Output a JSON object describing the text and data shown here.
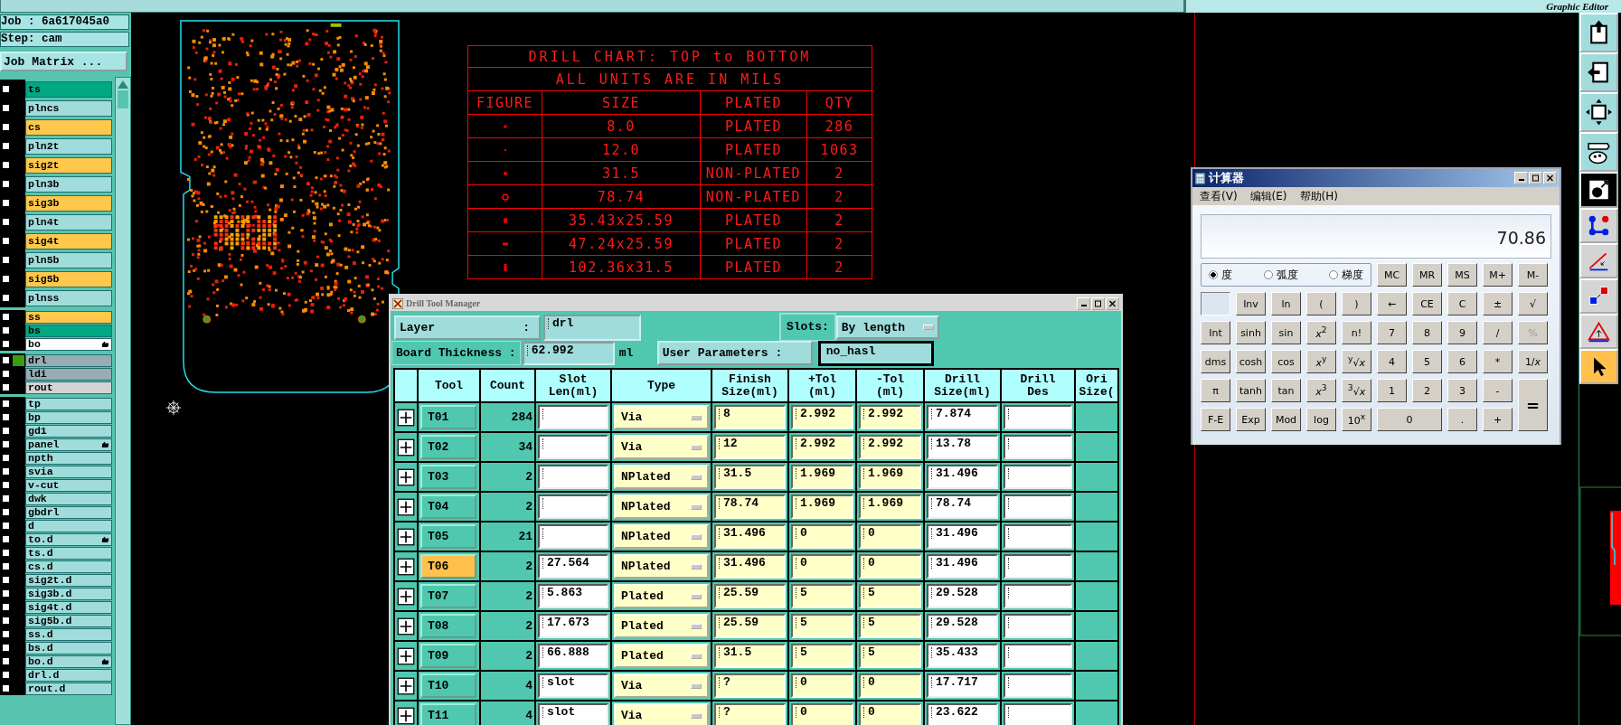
{
  "top_bar": {
    "title": "Graphic Editor"
  },
  "job": {
    "job": "Job : 6a617045a0",
    "step": "Step: cam",
    "matrix_button": "Job Matrix ..."
  },
  "layer_groups": [
    {
      "layers": [
        {
          "name": "ts",
          "color": "#00a884",
          "checked": false,
          "active": false,
          "tagged": false
        },
        {
          "name": "plncs",
          "color": "#a0dcdc",
          "checked": false,
          "active": false,
          "tagged": false
        },
        {
          "name": "cs",
          "color": "#ffc84c",
          "checked": false,
          "active": false,
          "tagged": false
        },
        {
          "name": "pln2t",
          "color": "#a0dcdc",
          "checked": false,
          "active": false,
          "tagged": false
        },
        {
          "name": "sig2t",
          "color": "#ffc84c",
          "checked": false,
          "active": false,
          "tagged": false
        },
        {
          "name": "pln3b",
          "color": "#a0dcdc",
          "checked": false,
          "active": false,
          "tagged": false
        },
        {
          "name": "sig3b",
          "color": "#ffc84c",
          "checked": false,
          "active": false,
          "tagged": false
        },
        {
          "name": "pln4t",
          "color": "#a0dcdc",
          "checked": false,
          "active": false,
          "tagged": false
        },
        {
          "name": "sig4t",
          "color": "#ffc84c",
          "checked": false,
          "active": false,
          "tagged": false
        },
        {
          "name": "pln5b",
          "color": "#a0dcdc",
          "checked": false,
          "active": false,
          "tagged": false
        },
        {
          "name": "sig5b",
          "color": "#ffc84c",
          "checked": false,
          "active": false,
          "tagged": false
        },
        {
          "name": "plnss",
          "color": "#a0dcdc",
          "checked": false,
          "active": false,
          "tagged": false
        }
      ]
    },
    {
      "layers": [
        {
          "name": "ss",
          "color": "#ffc84c",
          "checked": false,
          "active": false,
          "tagged": false
        },
        {
          "name": "bs",
          "color": "#00a884",
          "checked": false,
          "active": false,
          "tagged": false
        },
        {
          "name": "bo",
          "color": "#ffffff",
          "checked": false,
          "active": false,
          "tagged": true
        }
      ]
    },
    {
      "layers": [
        {
          "name": "drl",
          "color": "#98acb4",
          "checked": false,
          "active": true,
          "tagged": false
        },
        {
          "name": "ldi",
          "color": "#98acb4",
          "checked": false,
          "active": false,
          "tagged": false
        },
        {
          "name": "rout",
          "color": "#d4d4d4",
          "checked": false,
          "active": false,
          "tagged": false
        }
      ]
    },
    {
      "layers": [
        {
          "name": "tp",
          "color": "#a0dcdc",
          "checked": false,
          "active": false,
          "tagged": false
        },
        {
          "name": "bp",
          "color": "#a0dcdc",
          "checked": false,
          "active": false,
          "tagged": false
        },
        {
          "name": "gd1",
          "color": "#a0dcdc",
          "checked": false,
          "active": false,
          "tagged": false
        },
        {
          "name": "panel",
          "color": "#a0dcdc",
          "checked": false,
          "active": false,
          "tagged": true
        },
        {
          "name": "npth",
          "color": "#a0dcdc",
          "checked": false,
          "active": false,
          "tagged": false
        },
        {
          "name": "svia",
          "color": "#a0dcdc",
          "checked": false,
          "active": false,
          "tagged": false
        },
        {
          "name": "v-cut",
          "color": "#a0dcdc",
          "checked": false,
          "active": false,
          "tagged": false
        },
        {
          "name": "dwk",
          "color": "#a0dcdc",
          "checked": false,
          "active": false,
          "tagged": false
        },
        {
          "name": "gbdrl",
          "color": "#a0dcdc",
          "checked": false,
          "active": false,
          "tagged": false
        },
        {
          "name": "d",
          "color": "#a0dcdc",
          "checked": false,
          "active": false,
          "tagged": false
        },
        {
          "name": "to.d",
          "color": "#a0dcdc",
          "checked": false,
          "active": false,
          "tagged": true
        },
        {
          "name": "ts.d",
          "color": "#a0dcdc",
          "checked": false,
          "active": false,
          "tagged": false
        },
        {
          "name": "cs.d",
          "color": "#a0dcdc",
          "checked": false,
          "active": false,
          "tagged": false
        },
        {
          "name": "sig2t.d",
          "color": "#a0dcdc",
          "checked": false,
          "active": false,
          "tagged": false
        },
        {
          "name": "sig3b.d",
          "color": "#a0dcdc",
          "checked": false,
          "active": false,
          "tagged": false
        },
        {
          "name": "sig4t.d",
          "color": "#a0dcdc",
          "checked": false,
          "active": false,
          "tagged": false
        },
        {
          "name": "sig5b.d",
          "color": "#a0dcdc",
          "checked": false,
          "active": false,
          "tagged": false
        },
        {
          "name": "ss.d",
          "color": "#a0dcdc",
          "checked": false,
          "active": false,
          "tagged": false
        },
        {
          "name": "bs.d",
          "color": "#a0dcdc",
          "checked": false,
          "active": false,
          "tagged": false
        },
        {
          "name": "bo.d",
          "color": "#a0dcdc",
          "checked": false,
          "active": false,
          "tagged": true
        },
        {
          "name": "drl.d",
          "color": "#a0dcdc",
          "checked": false,
          "active": false,
          "tagged": false
        },
        {
          "name": "rout.d",
          "color": "#a0dcdc",
          "checked": false,
          "active": false,
          "tagged": false
        }
      ]
    }
  ],
  "drill_chart": {
    "title": "DRILL CHART: TOP to BOTTOM",
    "subtitle": "ALL UNITS ARE IN MILS",
    "columns": [
      "FIGURE",
      "SIZE",
      "PLATED",
      "QTY"
    ],
    "rows": [
      {
        "kind": "square-dot",
        "size": "8.0",
        "plated": "PLATED",
        "qty": "286"
      },
      {
        "kind": "tiny-dot",
        "size": "12.0",
        "plated": "PLATED",
        "qty": "1063"
      },
      {
        "kind": "round-dot",
        "size": "31.5",
        "plated": "NON-PLATED",
        "qty": "2"
      },
      {
        "kind": "ring",
        "size": "78.74",
        "plated": "NON-PLATED",
        "qty": "2"
      },
      {
        "kind": "square",
        "size": "35.43x25.59",
        "plated": "PLATED",
        "qty": "2"
      },
      {
        "kind": "bar",
        "size": "47.24x25.59",
        "plated": "PLATED",
        "qty": "2"
      },
      {
        "kind": "slot",
        "size": "102.36x31.5",
        "plated": "PLATED",
        "qty": "2"
      }
    ]
  },
  "drill_tool_manager": {
    "title": "Drill Tool Manager",
    "layer_label": "Layer",
    "layer_colon": ":",
    "layer": "drl",
    "slots_label": "Slots:",
    "slots": "By length",
    "thickness_label": "Board Thickness :",
    "thickness": "62.992",
    "thickness_unit": "ml",
    "user_params_button": "User Parameters :",
    "user_params": "no_hasl",
    "columns": [
      {
        "lines": [
          "Tool"
        ]
      },
      {
        "lines": [
          "Count"
        ]
      },
      {
        "lines": [
          "Slot",
          "Len(ml)"
        ]
      },
      {
        "lines": [
          "Type"
        ]
      },
      {
        "lines": [
          "Finish",
          "Size(ml)"
        ]
      },
      {
        "lines": [
          "+Tol",
          "(ml)"
        ]
      },
      {
        "lines": [
          "-Tol",
          "(ml)"
        ]
      },
      {
        "lines": [
          "Drill",
          "Size(ml)"
        ]
      },
      {
        "lines": [
          "Drill",
          "Des"
        ]
      },
      {
        "lines": [
          "Ori",
          "Size("
        ]
      }
    ],
    "rows": [
      {
        "tool": "T01",
        "selected": false,
        "count": "284",
        "type": "Via",
        "finish": "8",
        "plus_tol": "2.992",
        "minus_tol": "2.992",
        "drill_size": "7.874"
      },
      {
        "tool": "T02",
        "selected": false,
        "count": "34",
        "type": "Via",
        "finish": "12",
        "plus_tol": "2.992",
        "minus_tol": "2.992",
        "drill_size": "13.78"
      },
      {
        "tool": "T03",
        "selected": false,
        "count": "2",
        "type": "NPlated",
        "finish": "31.5",
        "plus_tol": "1.969",
        "minus_tol": "1.969",
        "drill_size": "31.496"
      },
      {
        "tool": "T04",
        "selected": false,
        "count": "2",
        "type": "NPlated",
        "finish": "78.74",
        "plus_tol": "1.969",
        "minus_tol": "1.969",
        "drill_size": "78.74"
      },
      {
        "tool": "T05",
        "selected": false,
        "count": "21",
        "type": "NPlated",
        "finish": "31.496",
        "plus_tol": "0",
        "minus_tol": "0",
        "drill_size": "31.496"
      },
      {
        "tool": "T06",
        "selected": true,
        "count": "2",
        "slot_len": "27.564",
        "type": "NPlated",
        "finish": "31.496",
        "plus_tol": "0",
        "minus_tol": "0",
        "drill_size": "31.496"
      },
      {
        "tool": "T07",
        "selected": false,
        "count": "2",
        "slot_len": "5.863",
        "type": "Plated",
        "finish": "25.59",
        "plus_tol": "5",
        "minus_tol": "5",
        "drill_size": "29.528"
      },
      {
        "tool": "T08",
        "selected": false,
        "count": "2",
        "slot_len": "17.673",
        "type": "Plated",
        "finish": "25.59",
        "plus_tol": "5",
        "minus_tol": "5",
        "drill_size": "29.528"
      },
      {
        "tool": "T09",
        "selected": false,
        "count": "2",
        "slot_len": "66.888",
        "type": "Plated",
        "finish": "31.5",
        "plus_tol": "5",
        "minus_tol": "5",
        "drill_size": "35.433"
      },
      {
        "tool": "T10",
        "selected": false,
        "count": "4",
        "slot_len": "slot",
        "type": "Via",
        "finish": "?",
        "plus_tol": "0",
        "minus_tol": "0",
        "drill_size": "17.717"
      },
      {
        "tool": "T11",
        "selected": false,
        "count": "4",
        "slot_len": "slot",
        "type": "Via",
        "finish": "?",
        "plus_tol": "0",
        "minus_tol": "0",
        "drill_size": "23.622"
      }
    ]
  },
  "calculator": {
    "title": "计算器",
    "menu": [
      "查看(V)",
      "编辑(E)",
      "帮助(H)"
    ],
    "display": "70.86",
    "angle_units": [
      {
        "label": "度",
        "selected": true
      },
      {
        "label": "弧度",
        "selected": false
      },
      {
        "label": "梯度",
        "selected": false
      }
    ],
    "memory_keys": [
      "MC",
      "MR",
      "MS",
      "M+",
      "M-"
    ],
    "keys": [
      {
        "label": "Inv",
        "kind": "key"
      },
      {
        "label": "ln",
        "kind": "key"
      },
      {
        "label": "(",
        "kind": "key"
      },
      {
        "label": ")",
        "kind": "key"
      },
      {
        "label": "←",
        "kind": "key"
      },
      {
        "label": "CE",
        "kind": "key"
      },
      {
        "label": "C",
        "kind": "key"
      },
      {
        "label": "±",
        "kind": "key"
      },
      {
        "label": "√",
        "kind": "key"
      },
      {
        "label": "Int",
        "kind": "key"
      },
      {
        "label": "sinh",
        "kind": "key"
      },
      {
        "label": "sin",
        "kind": "key"
      },
      {
        "label": "*x*$^{2}$",
        "kind": "key"
      },
      {
        "label": "n!",
        "kind": "key"
      },
      {
        "label": "7",
        "kind": "key"
      },
      {
        "label": "8",
        "kind": "key"
      },
      {
        "label": "9",
        "kind": "key"
      },
      {
        "label": "/",
        "kind": "key"
      },
      {
        "label": "%",
        "kind": "greyed"
      },
      {
        "label": "dms",
        "kind": "key"
      },
      {
        "label": "cosh",
        "kind": "key"
      },
      {
        "label": "cos",
        "kind": "key"
      },
      {
        "label": "*x*$^{y}$",
        "kind": "key"
      },
      {
        "label": "$^{y}$√*x*",
        "kind": "key"
      },
      {
        "label": "4",
        "kind": "key"
      },
      {
        "label": "5",
        "kind": "key"
      },
      {
        "label": "6",
        "kind": "key"
      },
      {
        "label": "*",
        "kind": "key"
      },
      {
        "label": "1/*x*",
        "kind": "key"
      },
      {
        "label": "π",
        "kind": "key"
      },
      {
        "label": "tanh",
        "kind": "key"
      },
      {
        "label": "tan",
        "kind": "key"
      },
      {
        "label": "*x*$^{3}$",
        "kind": "key"
      },
      {
        "label": "$^{3}$√*x*",
        "kind": "key"
      },
      {
        "label": "1",
        "kind": "key"
      },
      {
        "label": "2",
        "kind": "key"
      },
      {
        "label": "3",
        "kind": "key"
      },
      {
        "label": "-",
        "kind": "key"
      },
      {
        "label": "=",
        "kind": "tall"
      },
      {
        "label": "F-E",
        "kind": "key"
      },
      {
        "label": "Exp",
        "kind": "key"
      },
      {
        "label": "Mod",
        "kind": "key"
      },
      {
        "label": "log",
        "kind": "key"
      },
      {
        "label": "10$^{x}$",
        "kind": "key"
      },
      {
        "label": "0",
        "kind": "wide"
      },
      {
        "label": ".",
        "kind": "key"
      },
      {
        "label": "+",
        "kind": "key"
      }
    ]
  },
  "toolbar": [
    {
      "kind": "export",
      "selected": false
    },
    {
      "kind": "import",
      "selected": false
    },
    {
      "kind": "fit",
      "selected": false
    },
    {
      "kind": "tools",
      "selected": false
    },
    {
      "kind": "feature",
      "selected": false
    },
    {
      "kind": "nodes",
      "selected": false
    },
    {
      "kind": "line",
      "selected": false
    },
    {
      "kind": "snap",
      "selected": false
    },
    {
      "kind": "measure",
      "selected": false
    },
    {
      "kind": "pointer",
      "selected": true
    }
  ]
}
